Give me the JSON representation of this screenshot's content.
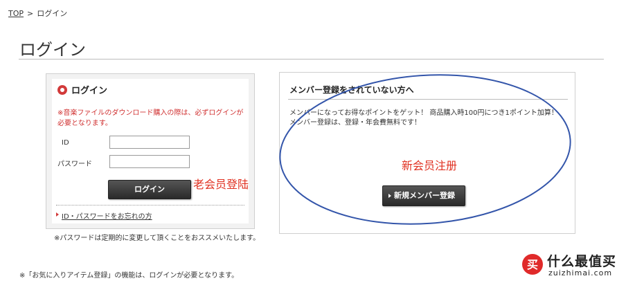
{
  "breadcrumb": {
    "home": "TOP",
    "separator": ">",
    "current": "ログイン"
  },
  "page_title": "ログイン",
  "login": {
    "title": "ログイン",
    "note": "※音楽ファイルのダウンロード購入の際は、必ずログインが必要となります。",
    "id_label": "ID",
    "password_label": "パスワード",
    "button": "ログイン",
    "forgot": "ID・パスワードをお忘れの方"
  },
  "password_note": "※パスワードは定期的に変更して頂くことをおススメいたします。",
  "favorites_note": "※「お気に入りアイテム登録」の機能は、ログインが必要となります。",
  "member": {
    "title": "メンバー登録をされていない方へ",
    "text_1": "メンバーになってお得なポイントをゲット！ 商品購入時100円につき1ポイント加算！",
    "text_2": "メンバー登録は、登録・年会費無料です！",
    "button": "新規メンバー登録"
  },
  "annotations": {
    "old_member": "老会员登陆",
    "new_member": "新会员注册",
    "ellipse_color": "#3355aa",
    "text_color": "#e03020"
  },
  "watermark": {
    "name": "什么最值买",
    "url": "zuizhimai.com",
    "logo_char": "买"
  }
}
